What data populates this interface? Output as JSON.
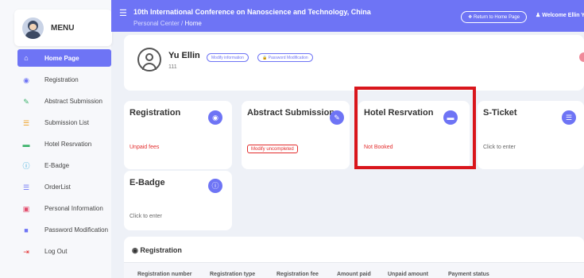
{
  "sidebar": {
    "menu_label": "MENU",
    "items": [
      {
        "label": "Home Page",
        "icon": "home-icon",
        "glyph": "⌂"
      },
      {
        "label": "Registration",
        "icon": "user-circle-icon",
        "glyph": "◉"
      },
      {
        "label": "Abstract Submission",
        "icon": "edit-icon",
        "glyph": "✎"
      },
      {
        "label": "Submission List",
        "icon": "list-icon",
        "glyph": "☰"
      },
      {
        "label": "Hotel Resrvation",
        "icon": "bed-icon",
        "glyph": "▬"
      },
      {
        "label": "E-Badge",
        "icon": "info-icon",
        "glyph": "ⓘ"
      },
      {
        "label": "OrderList",
        "icon": "orderlist-icon",
        "glyph": "☰"
      },
      {
        "label": "Personal Information",
        "icon": "id-card-icon",
        "glyph": "▣"
      },
      {
        "label": "Password Modification",
        "icon": "lock-icon",
        "glyph": "■"
      },
      {
        "label": "Log Out",
        "icon": "logout-icon",
        "glyph": "⇥"
      }
    ]
  },
  "topbar": {
    "title": "10th International Conference on Nanoscience and Technology, China",
    "breadcrumb_parent": "Personal Center",
    "breadcrumb_sep": "/",
    "breadcrumb_current": "Home",
    "home_button": "❖ Return to Home Page",
    "welcome": "♟ Welcome Ellin Yu"
  },
  "profile": {
    "name": "Yu Ellin",
    "id": "111",
    "modify_info": "Modify information",
    "password_mod": "🔒 Password Modification"
  },
  "cards": {
    "registration": {
      "title": "Registration",
      "status": "Unpaid fees"
    },
    "abstract": {
      "title": "Abstract Submission",
      "status": "Modify uncompleted"
    },
    "hotel": {
      "title": "Hotel Resrvation",
      "status": "Not Booked"
    },
    "sticket": {
      "title": "S-Ticket",
      "status": "Click to enter"
    },
    "ebadge": {
      "title": "E-Badge",
      "status": "Click to enter"
    }
  },
  "registration_panel": {
    "title": "Registration",
    "columns": [
      "Registration number",
      "Registration type",
      "Registration fee",
      "Amount paid",
      "Unpaid amount",
      "Payment status"
    ]
  },
  "colors": {
    "accent": "#6e74f5",
    "alert": "#e32d2d",
    "highlight": "#d9161c"
  }
}
